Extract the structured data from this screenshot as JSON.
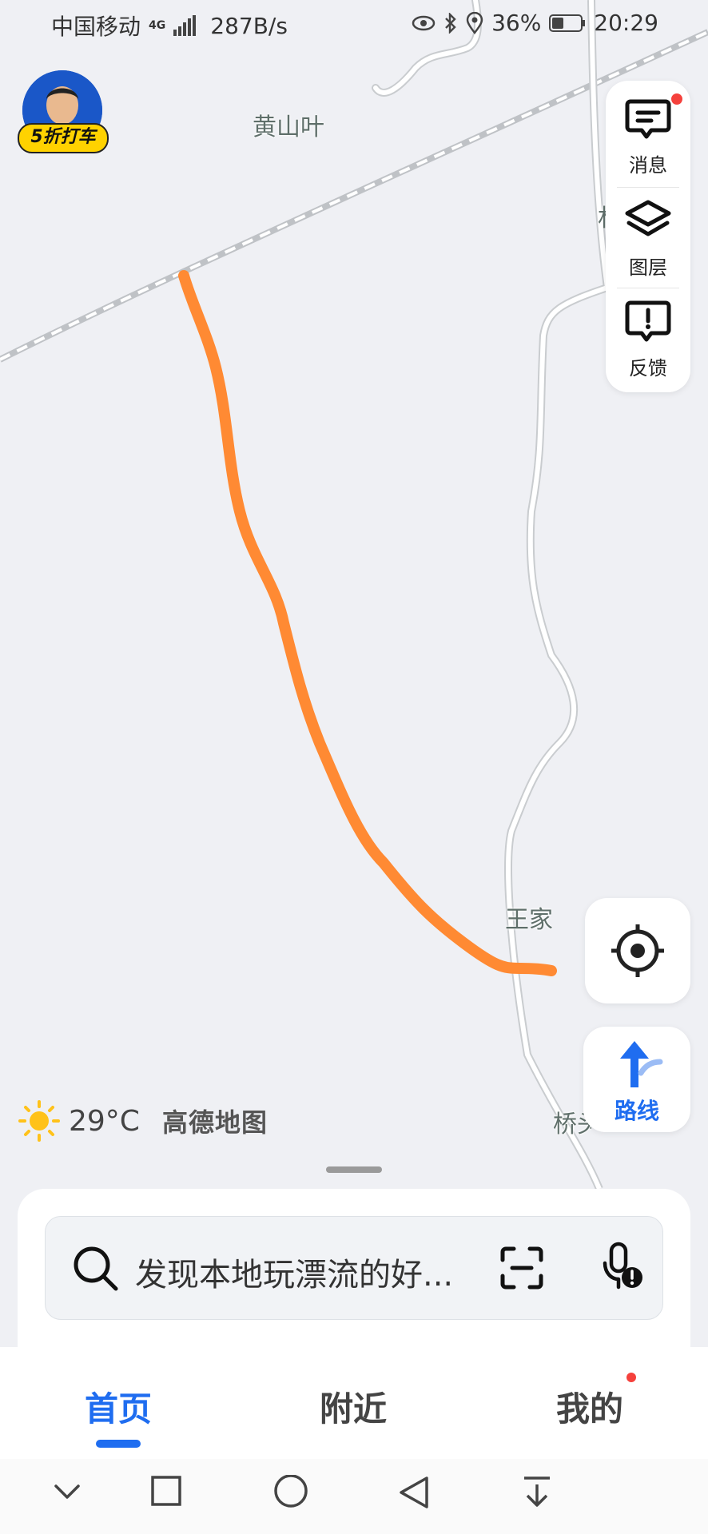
{
  "status_bar": {
    "carrier": "中国移动",
    "network_type": "4G",
    "speed": "287B/s",
    "battery": "36%",
    "time": "20:29"
  },
  "promo": {
    "badge": "5折打车"
  },
  "map_labels": {
    "huangshanye": "黄山叶",
    "wangjia": "王家",
    "qiao": "桥头",
    "partial": "林"
  },
  "right_panel": {
    "messages": "消息",
    "layers": "图层",
    "feedback": "反馈"
  },
  "route_button": {
    "label": "路线"
  },
  "weather": {
    "temperature": "29°C",
    "brand": "高德地图"
  },
  "search": {
    "placeholder": "发现本地玩漂流的好..."
  },
  "tabs": [
    {
      "label": "首页"
    },
    {
      "label": "附近"
    },
    {
      "label": "我的"
    }
  ],
  "colors": {
    "accent": "#1f6df0",
    "route": "#ff8a33",
    "notification": "#f5413c",
    "map_background": "#eff0f4"
  }
}
